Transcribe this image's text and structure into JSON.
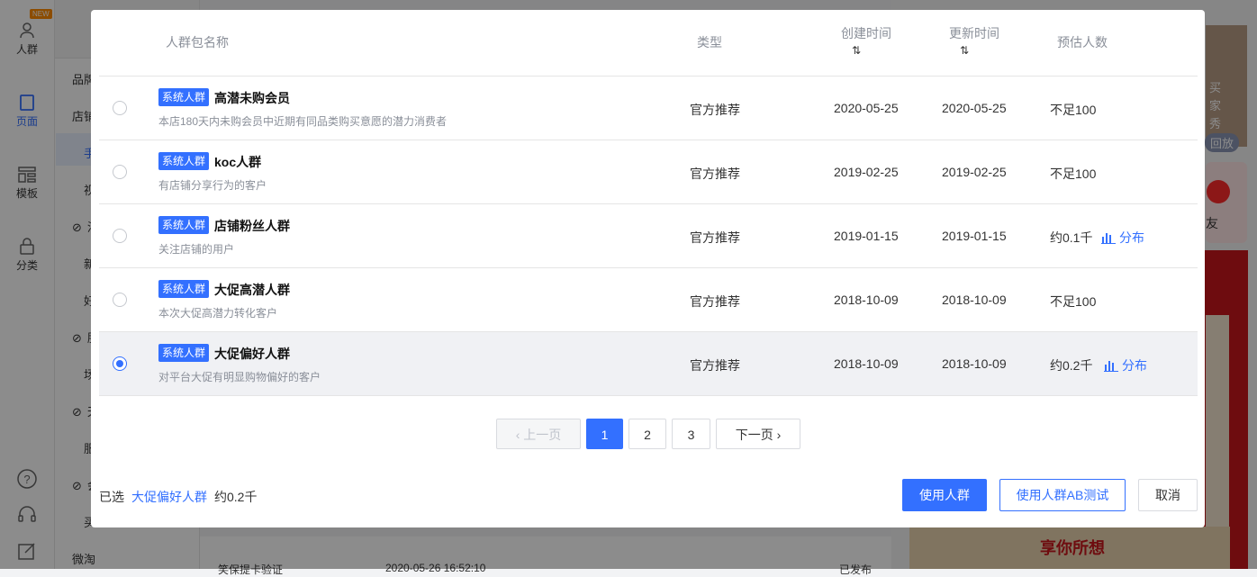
{
  "app": {
    "rail": [
      {
        "label": "人群",
        "icon": "user-icon",
        "badge": "NEW"
      },
      {
        "label": "页面",
        "icon": "page-icon"
      },
      {
        "label": "模板",
        "icon": "template-icon"
      },
      {
        "label": "分类",
        "icon": "category-icon"
      }
    ],
    "sidebar": [
      "品牌",
      "店铺",
      "手",
      "视",
      "活",
      "新",
      "好",
      "服",
      "场",
      "天",
      "服",
      "会",
      "买",
      "微淘"
    ],
    "background_row": {
      "col1": "笑保提卡验证",
      "col2": "2020-05-26 16:52:10",
      "col3": "已发布"
    },
    "preview": {
      "side_top": "买家秀",
      "replay": "回放",
      "friend": "友",
      "promo": "享你所想"
    }
  },
  "table": {
    "headers": {
      "name": "人群包名称",
      "type": "类型",
      "created": "创建时间",
      "updated": "更新时间",
      "estimate": "预估人数",
      "sort_symbol": "⇅"
    },
    "rows": [
      {
        "tag": "系统人群",
        "name": "高潜未购会员",
        "desc": "本店180天内未购会员中近期有同品类购买意愿的潜力消费者",
        "type": "官方推荐",
        "created": "2020-05-25",
        "updated": "2020-05-25",
        "estimate": "不足100",
        "dist": "",
        "selected": false
      },
      {
        "tag": "系统人群",
        "name": "koc人群",
        "desc": "有店铺分享行为的客户",
        "type": "官方推荐",
        "created": "2019-02-25",
        "updated": "2019-02-25",
        "estimate": "不足100",
        "dist": "",
        "selected": false
      },
      {
        "tag": "系统人群",
        "name": "店铺粉丝人群",
        "desc": "关注店铺的用户",
        "type": "官方推荐",
        "created": "2019-01-15",
        "updated": "2019-01-15",
        "estimate": "约0.1千",
        "dist": "分布",
        "selected": false
      },
      {
        "tag": "系统人群",
        "name": "大促高潜人群",
        "desc": "本次大促高潜力转化客户",
        "type": "官方推荐",
        "created": "2018-10-09",
        "updated": "2018-10-09",
        "estimate": "不足100",
        "dist": "",
        "selected": false
      },
      {
        "tag": "系统人群",
        "name": "大促偏好人群",
        "desc": "对平台大促有明显购物偏好的客户",
        "type": "官方推荐",
        "created": "2018-10-09",
        "updated": "2018-10-09",
        "estimate": "约0.2千",
        "dist": "分布",
        "selected": true
      }
    ]
  },
  "pagination": {
    "prev": "上一页",
    "next": "下一页",
    "pages": [
      "1",
      "2",
      "3"
    ],
    "current": "1"
  },
  "footer": {
    "selected_label": "已选",
    "selected_name": "大促偏好人群",
    "selected_estimate": "约0.2千",
    "use_button": "使用人群",
    "ab_button": "使用人群AB测试",
    "cancel_button": "取消"
  },
  "colors": {
    "accent": "#3370ff",
    "tag": "#3370ff",
    "mask": "rgba(0,0,0,0.45)"
  }
}
